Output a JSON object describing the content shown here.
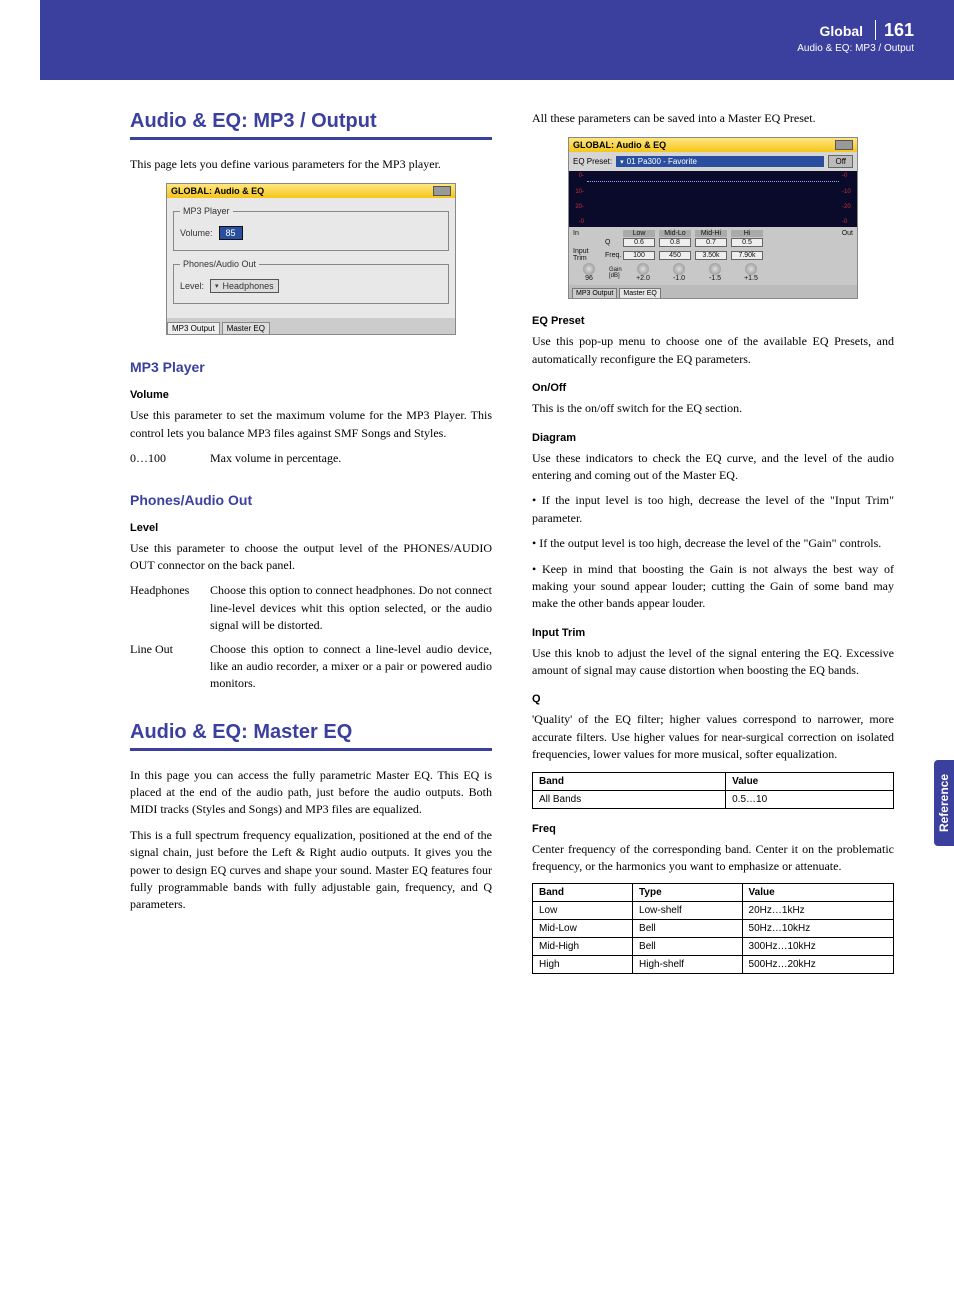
{
  "header": {
    "section": "Global",
    "page_number": "161",
    "breadcrumb": "Audio & EQ: MP3 / Output"
  },
  "side_tab": "Reference",
  "left": {
    "h1a": "Audio & EQ: MP3 / Output",
    "intro_a": "This page lets you define various parameters for the MP3 player.",
    "shot1": {
      "title": "GLOBAL: Audio & EQ",
      "grp1_legend": "MP3 Player",
      "grp1_label": "Volume:",
      "grp1_value": "85",
      "grp2_legend": "Phones/Audio Out",
      "grp2_label": "Level:",
      "grp2_value": "Headphones",
      "tab1": "MP3 Output",
      "tab2": "Master EQ"
    },
    "h2_mp3": "MP3 Player",
    "h3_vol": "Volume",
    "p_vol": "Use this parameter to set the maximum volume for the MP3 Player. This control lets you balance MP3 files against SMF Songs and Styles.",
    "def_vol_term": "0…100",
    "def_vol_def": "Max volume in percentage.",
    "h2_phones": "Phones/Audio Out",
    "h3_level": "Level",
    "p_level": "Use this parameter to choose the output level of the PHONES/AUDIO OUT connector on the back panel.",
    "def_hp_term": "Headphones",
    "def_hp_def": "Choose this option to connect headphones. Do not connect line-level devices whit this option selected, or the audio signal will be distorted.",
    "def_lo_term": "Line Out",
    "def_lo_def": "Choose this option to connect a line-level audio device, like an audio recorder, a mixer or a pair or powered audio monitors.",
    "h1b": "Audio & EQ: Master EQ",
    "p_master1": "In this page you can access the fully parametric Master EQ. This EQ is placed at the end of the audio path, just before the audio outputs. Both MIDI tracks (Styles and Songs) and MP3 files are equalized.",
    "p_master2": "This is a full spectrum frequency equalization, positioned at the end of the signal chain, just before the Left & Right audio outputs. It gives you the power to design EQ curves and shape your sound. Master EQ features four fully programmable bands with fully adjustable gain, frequency, and Q parameters."
  },
  "right": {
    "p_saved": "All these parameters can be saved into a Master EQ Preset.",
    "shot2": {
      "title": "GLOBAL: Audio & EQ",
      "preset_label": "EQ Preset:",
      "preset_value": "01 Pa300 - Favorite",
      "off_btn": "Off",
      "ticks": [
        "0-",
        "10-",
        "20-",
        "-0"
      ],
      "rticks": [
        "-0",
        "-10",
        "-20",
        "-0"
      ],
      "in_lbl": "In",
      "out_lbl": "Out",
      "cols": [
        "Low",
        "Mid-Lo",
        "Mid-Hi",
        "Hi"
      ],
      "q_lbl": "Q",
      "q_vals": [
        "0.6",
        "0.8",
        "0.7",
        "0.5"
      ],
      "trim_lbl": "Input Trim",
      "trim_val": "96",
      "freq_lbl": "Freq.",
      "freq_vals": [
        "100",
        "450",
        "3.50k",
        "7.90k"
      ],
      "gain_lbl": "Gain [dB]",
      "gain_vals": [
        "+2.0",
        "-1.0",
        "-1.5",
        "+1.5"
      ],
      "tab1": "MP3 Output",
      "tab2": "Master EQ"
    },
    "h3_eqpreset": "EQ Preset",
    "p_eqpreset": "Use this pop-up menu to choose one of the available EQ Presets, and automatically reconfigure the EQ parameters.",
    "h3_onoff": "On/Off",
    "p_onoff": "This is the on/off switch for the EQ section.",
    "h3_diagram": "Diagram",
    "p_diagram": "Use these indicators to check the EQ curve, and the level of the audio entering and coming out of the Master EQ.",
    "p_d1": "If the input level is too high, decrease the level of the \"Input Trim\" parameter.",
    "p_d2": "If the output level is too high, decrease the level of the \"Gain\" controls.",
    "p_d3": "Keep in mind that boosting the Gain is not always the best way of making your sound appear louder; cutting the Gain of some band may make the other bands appear louder.",
    "h3_trim": "Input Trim",
    "p_trim": "Use this knob to adjust the level of the signal entering the EQ. Excessive amount of signal may cause distortion when boosting the EQ bands.",
    "h3_q": "Q",
    "p_q": "'Quality' of the EQ filter; higher values correspond to narrower, more accurate filters. Use higher values for near-surgical correction on isolated frequencies, lower values for more musical, softer equalization.",
    "tbl_q": {
      "h1": "Band",
      "h2": "Value",
      "r1c1": "All Bands",
      "r1c2": "0.5…10"
    },
    "h3_freq": "Freq",
    "p_freq": "Center frequency of the corresponding band. Center it on the problematic frequency, or the harmonics you want to emphasize or attenuate.",
    "tbl_freq": {
      "h1": "Band",
      "h2": "Type",
      "h3": "Value",
      "rows": [
        [
          "Low",
          "Low-shelf",
          "20Hz…1kHz"
        ],
        [
          "Mid-Low",
          "Bell",
          "50Hz…10kHz"
        ],
        [
          "Mid-High",
          "Bell",
          "300Hz…10kHz"
        ],
        [
          "High",
          "High-shelf",
          "500Hz…20kHz"
        ]
      ]
    }
  }
}
